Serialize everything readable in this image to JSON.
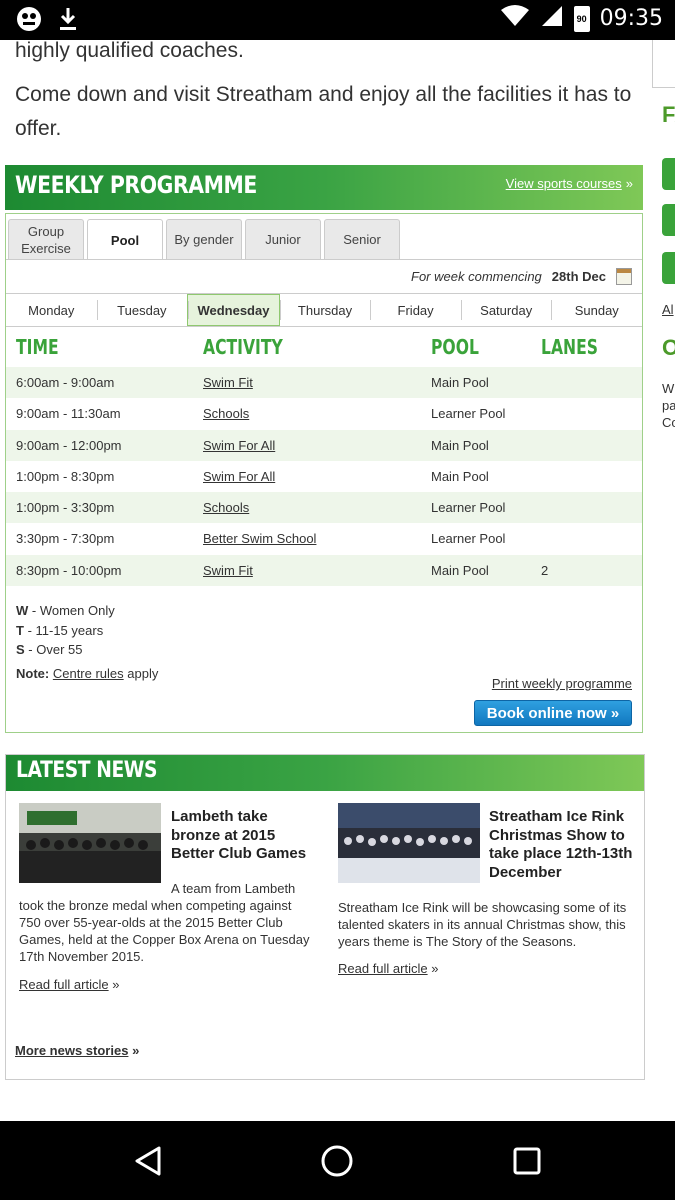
{
  "status_bar": {
    "time": "09:35",
    "battery": "90"
  },
  "intro": {
    "line1": "highly qualified coaches.",
    "line2": "Come down and visit Streatham and enjoy all the facilities it has to offer."
  },
  "sidebar": {
    "heading1": "FA",
    "link": "Al",
    "heading2": "OU",
    "text": "W\npa\nCo"
  },
  "programme": {
    "title": "WEEKLY PROGRAMME",
    "view_link": "View sports courses",
    "view_link_suffix": "»",
    "tabs": [
      "Group Exercise",
      "Pool",
      "By gender",
      "Junior",
      "Senior"
    ],
    "active_tab": "Pool",
    "week_label": "For week commencing",
    "week_date": "28th Dec",
    "days": [
      "Monday",
      "Tuesday",
      "Wednesday",
      "Thursday",
      "Friday",
      "Saturday",
      "Sunday"
    ],
    "active_day": "Wednesday",
    "columns": [
      "TIME",
      "ACTIVITY",
      "POOL",
      "LANES"
    ],
    "rows": [
      {
        "time": "6:00am - 9:00am",
        "activity": "Swim Fit",
        "pool": "Main Pool",
        "lanes": ""
      },
      {
        "time": "9:00am - 11:30am",
        "activity": "Schools",
        "pool": "Learner Pool",
        "lanes": ""
      },
      {
        "time": "9:00am - 12:00pm",
        "activity": "Swim For All",
        "pool": "Main Pool",
        "lanes": ""
      },
      {
        "time": "1:00pm - 8:30pm",
        "activity": "Swim For All",
        "pool": "Main Pool",
        "lanes": ""
      },
      {
        "time": "1:00pm - 3:30pm",
        "activity": "Schools",
        "pool": "Learner Pool",
        "lanes": ""
      },
      {
        "time": "3:30pm - 7:30pm",
        "activity": "Better Swim School",
        "pool": "Learner Pool",
        "lanes": ""
      },
      {
        "time": "8:30pm - 10:00pm",
        "activity": "Swim Fit",
        "pool": "Main Pool",
        "lanes": "2"
      }
    ],
    "legend": [
      {
        "key": "W",
        "text": " - Women Only"
      },
      {
        "key": "T",
        "text": " - 11-15 years"
      },
      {
        "key": "S",
        "text": " - Over 55"
      }
    ],
    "note_label": "Note:",
    "note_link": "Centre rules",
    "note_suffix": "apply",
    "print_link": "Print weekly programme",
    "book_button": "Book online now »"
  },
  "news": {
    "title": "LATEST NEWS",
    "articles": [
      {
        "headline": "Lambeth take bronze at 2015 Better Club Games",
        "body": "A team from Lambeth took the bronze medal when competing against 750 over 55-year-olds at the 2015 Better Club Games, held at the Copper Box Arena on Tuesday 17th November 2015.",
        "read_more": "Read full article",
        "read_more_suffix": "»"
      },
      {
        "headline": "Streatham Ice Rink Christmas Show to take place 12th-13th December",
        "body": "Streatham Ice Rink will be showcasing some of its talented skaters in its annual Christmas show, this years theme is The Story of the Seasons.",
        "read_more": "Read full article",
        "read_more_suffix": "»"
      }
    ],
    "more_link": "More news stories",
    "more_suffix": "»"
  },
  "colors": {
    "brand_green": "#3aa33a",
    "book_blue": "#1b88d0"
  }
}
